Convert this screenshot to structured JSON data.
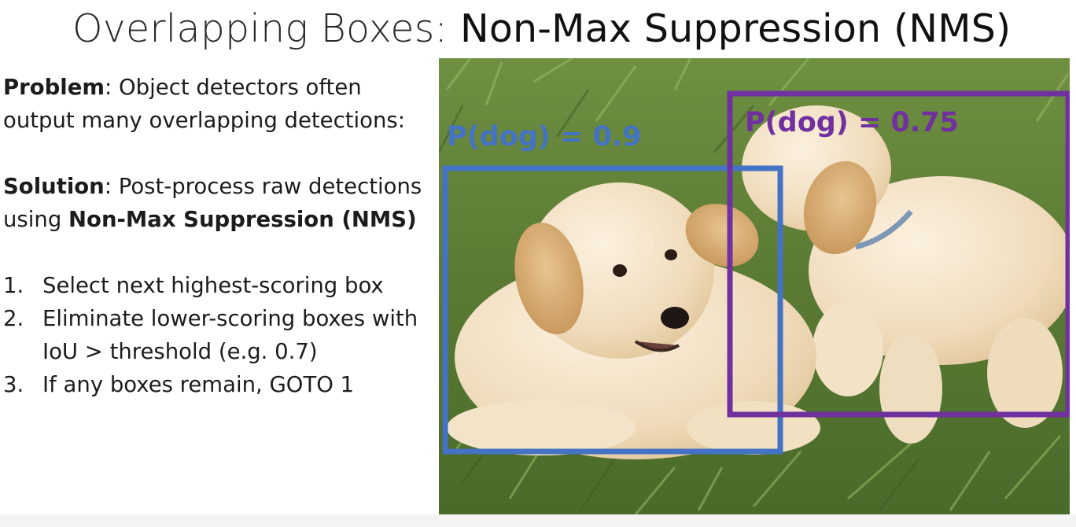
{
  "slide": {
    "title_part1": "Overlapping Boxes: ",
    "title_part2": "Non-Max Suppression (NMS)",
    "problem": {
      "label": "Problem",
      "text": ": Object detectors often output many overlapping detections:"
    },
    "solution": {
      "label": "Solution",
      "text_before": ": Post-process raw detections using ",
      "emphasis": "Non-Max Suppression (NMS)"
    },
    "steps": [
      {
        "num": "1.",
        "text": "Select next highest-scoring box"
      },
      {
        "num": "2.",
        "text": "Eliminate lower-scoring boxes with IoU > threshold (e.g. 0.7)"
      },
      {
        "num": "3.",
        "text": "If any boxes remain, GOTO 1"
      }
    ]
  },
  "boxes": [
    {
      "label": "P(dog) = 0.9",
      "color": "#4472c4"
    },
    {
      "label": "P(dog) = 0.75",
      "color": "#7030a0"
    }
  ],
  "colors": {
    "grass_dark": "#4f6b2e",
    "grass_light": "#8fae5a",
    "puppy": "#f1e0c3"
  }
}
